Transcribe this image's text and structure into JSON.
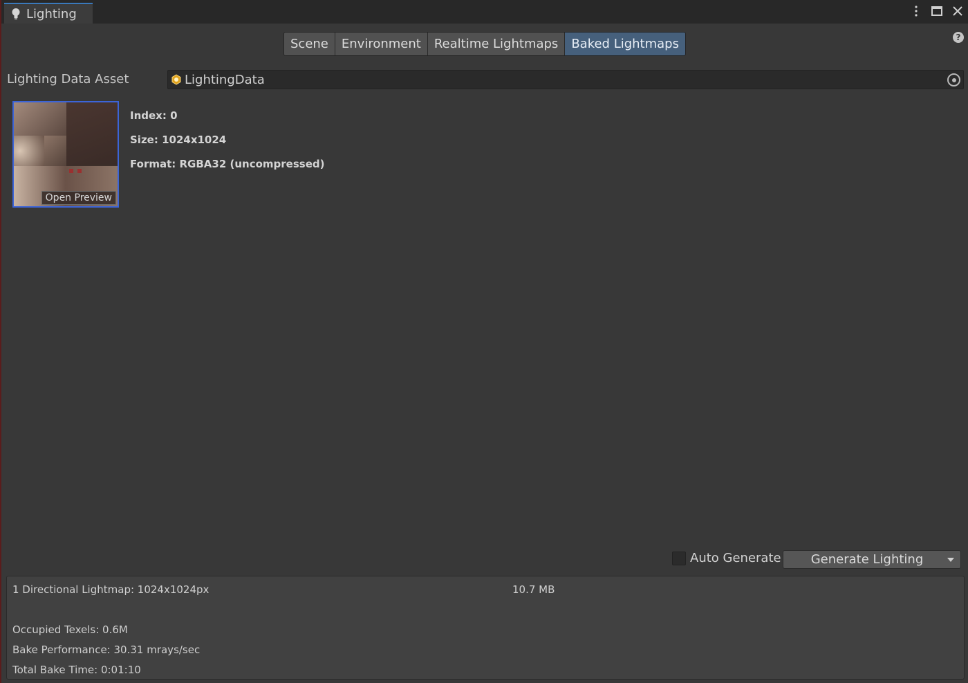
{
  "window": {
    "title": "Lighting",
    "icons": [
      "bulb-icon",
      "kebab-menu-icon",
      "maximize-icon",
      "close-icon"
    ]
  },
  "tabs": [
    {
      "label": "Scene",
      "active": false
    },
    {
      "label": "Environment",
      "active": false
    },
    {
      "label": "Realtime Lightmaps",
      "active": false
    },
    {
      "label": "Baked Lightmaps",
      "active": true
    }
  ],
  "lighting_data_asset": {
    "label": "Lighting Data Asset",
    "value": "LightingData"
  },
  "lightmap": {
    "preview_button": "Open Preview",
    "index": "Index: 0",
    "size": "Size: 1024x1024",
    "format": "Format: RGBA32 (uncompressed)"
  },
  "bake": {
    "auto_generate_label": "Auto Generate",
    "auto_generate_checked": false,
    "generate_button": "Generate Lighting"
  },
  "stats": {
    "lightmap_summary": "1 Directional Lightmap: 1024x1024px",
    "lightmap_size": "10.7 MB",
    "occupied_texels": "Occupied Texels: 0.6M",
    "bake_performance": "Bake Performance: 30.31 mrays/sec",
    "total_bake_time": "Total Bake Time: 0:01:10"
  },
  "colors": {
    "active_tab": "#46607c",
    "selection_border": "#3c64d8",
    "panel_bg": "#383838"
  }
}
